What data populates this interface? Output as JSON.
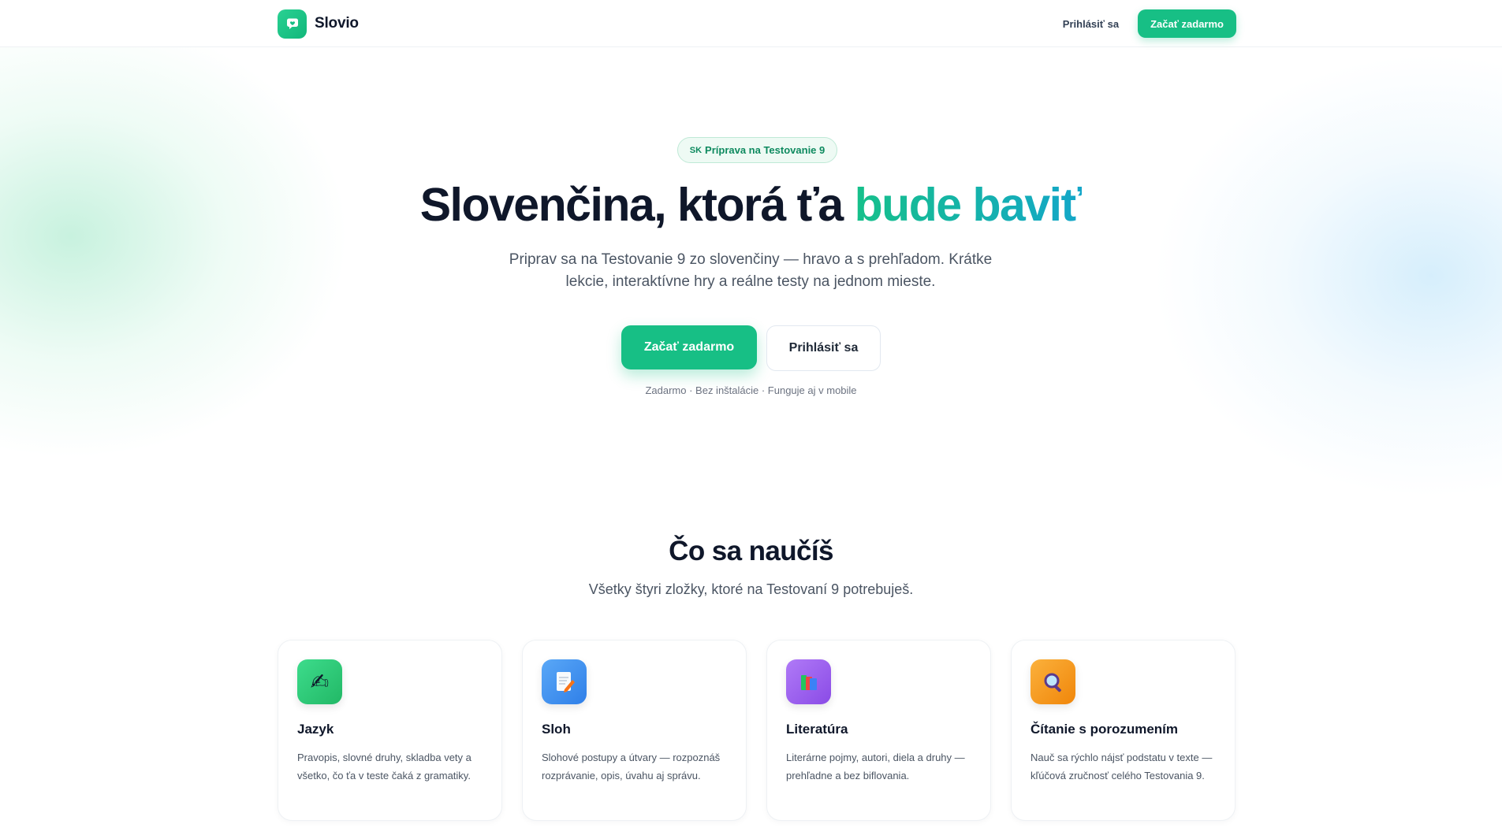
{
  "header": {
    "brand_name": "Slovio",
    "nav_login": "Prihlásiť sa",
    "nav_cta": "Začať zadarmo"
  },
  "hero": {
    "badge_flag": "SK",
    "badge_text": "Príprava na Testovanie 9",
    "title_main": "Slovenčina, ktorá ťa ",
    "title_accent": "bude baviť",
    "subtitle_line1": "Priprav sa na Testovanie 9 zo slovenčiny — hravo a s prehľadom. Krátke",
    "subtitle_line2": "lekcie, interaktívne hry a reálne testy na jednom mieste.",
    "primary_button": "Začať zadarmo",
    "secondary_button": "Prihlásiť sa",
    "note": "Zadarmo · Bez inštalácie · Funguje aj v mobile"
  },
  "learn": {
    "title": "Čo sa naučíš",
    "subtitle": "Všetky štyri zložky, ktoré na Testovaní 9 potrebuješ.",
    "cards": [
      {
        "icon": "writing-hand-icon",
        "title": "Jazyk",
        "text": "Pravopis, slovné druhy, skladba vety a všetko, čo ťa v teste čaká z gramatiky."
      },
      {
        "icon": "document-pencil-icon",
        "title": "Sloh",
        "text": "Slohové postupy a útvary — rozpoznáš rozprávanie, opis, úvahu aj správu."
      },
      {
        "icon": "books-icon",
        "title": "Literatúra",
        "text": "Literárne pojmy, autori, diela a druhy — prehľadne a bez biflovania."
      },
      {
        "icon": "magnifier-icon",
        "title": "Čítanie s porozumením",
        "text": "Nauč sa rýchlo nájsť podstatu v texte — kľúčová zručnosť celého Testovania 9."
      }
    ]
  },
  "colors": {
    "brand": "#17bf85",
    "accent_gradient_start": "#16c08a",
    "accent_gradient_end": "#14a6c9",
    "card_icon_jazyk": "#2fcf7f",
    "card_icon_sloh": "#3b8ff0",
    "card_icon_literatura": "#9b5cf0",
    "card_icon_citanie": "#f59e0b"
  }
}
